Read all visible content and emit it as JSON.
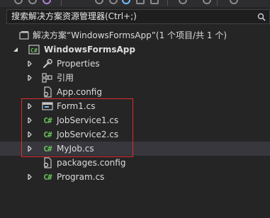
{
  "search": {
    "placeholder": "搜索解决方案资源管理器(Ctrl+;)"
  },
  "toolbar": {
    "icons": [
      "back-icon",
      "forward-icon",
      "sync-icon",
      "refresh-icon",
      "collapse-icon",
      "properties-icon"
    ]
  },
  "solution": {
    "label": "解决方案“WindowsFormsApp”(1 个项目/共 1 个)"
  },
  "project": {
    "label": "WindowsFormsApp"
  },
  "items": [
    {
      "label": "Properties",
      "icon": "wrench-icon",
      "expandable": true
    },
    {
      "label": "引用",
      "icon": "references-icon",
      "expandable": true
    },
    {
      "label": "App.config",
      "icon": "config-file-icon",
      "expandable": false
    },
    {
      "label": "Form1.cs",
      "icon": "form-icon",
      "expandable": true
    },
    {
      "label": "JobService1.cs",
      "icon": "csharp-file-icon",
      "expandable": true
    },
    {
      "label": "JobService2.cs",
      "icon": "csharp-file-icon",
      "expandable": true
    },
    {
      "label": "MyJob.cs",
      "icon": "csharp-file-icon",
      "expandable": true
    },
    {
      "label": "packages.config",
      "icon": "config-file-icon",
      "expandable": false
    },
    {
      "label": "Program.cs",
      "icon": "csharp-file-icon",
      "expandable": true
    }
  ],
  "colors": {
    "background": "#252526",
    "text": "#dcdcdc",
    "csharp_icon": "#6ac259",
    "highlight_box": "#e02b2b"
  }
}
